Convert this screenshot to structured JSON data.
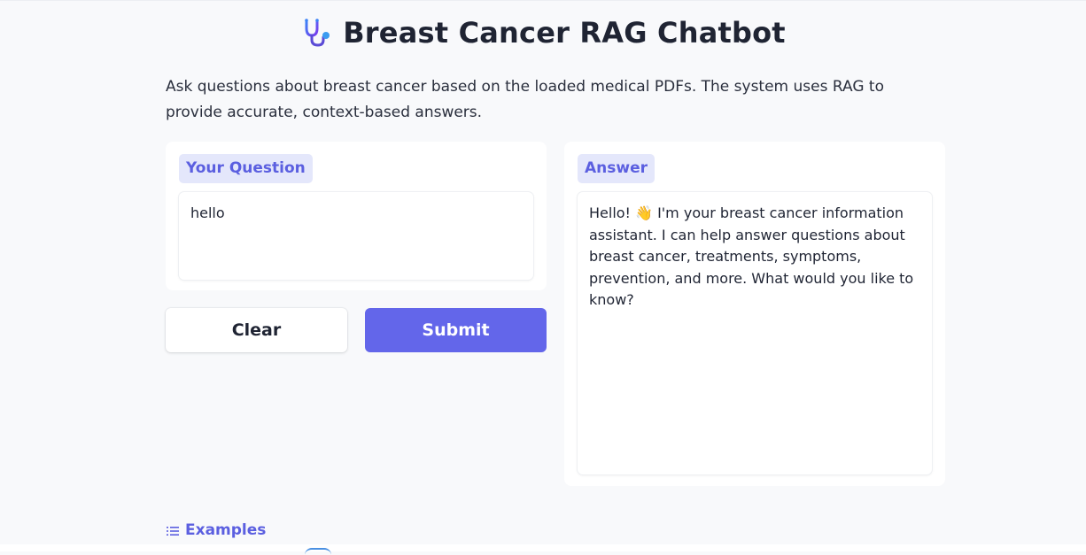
{
  "header": {
    "title": "Breast Cancer RAG Chatbot",
    "icon": "stethoscope-icon"
  },
  "description": "Ask questions about breast cancer based on the loaded medical PDFs. The system uses RAG to provide accurate, context-based answers.",
  "question": {
    "label": "Your Question",
    "value": "hello"
  },
  "answer": {
    "label": "Answer",
    "value": "Hello! 👋 I'm your breast cancer information assistant. I can help answer questions about breast cancer, treatments, symptoms, prevention, and more. What would you like to know?"
  },
  "buttons": {
    "clear_label": "Clear",
    "submit_label": "Submit"
  },
  "examples": {
    "label": "Examples",
    "icon": "list-icon"
  },
  "colors": {
    "accent": "#6366ea",
    "accent_text": "#5b5fe0",
    "chip_bg": "#e4e7fb",
    "page_bg": "#f8f9fb"
  }
}
